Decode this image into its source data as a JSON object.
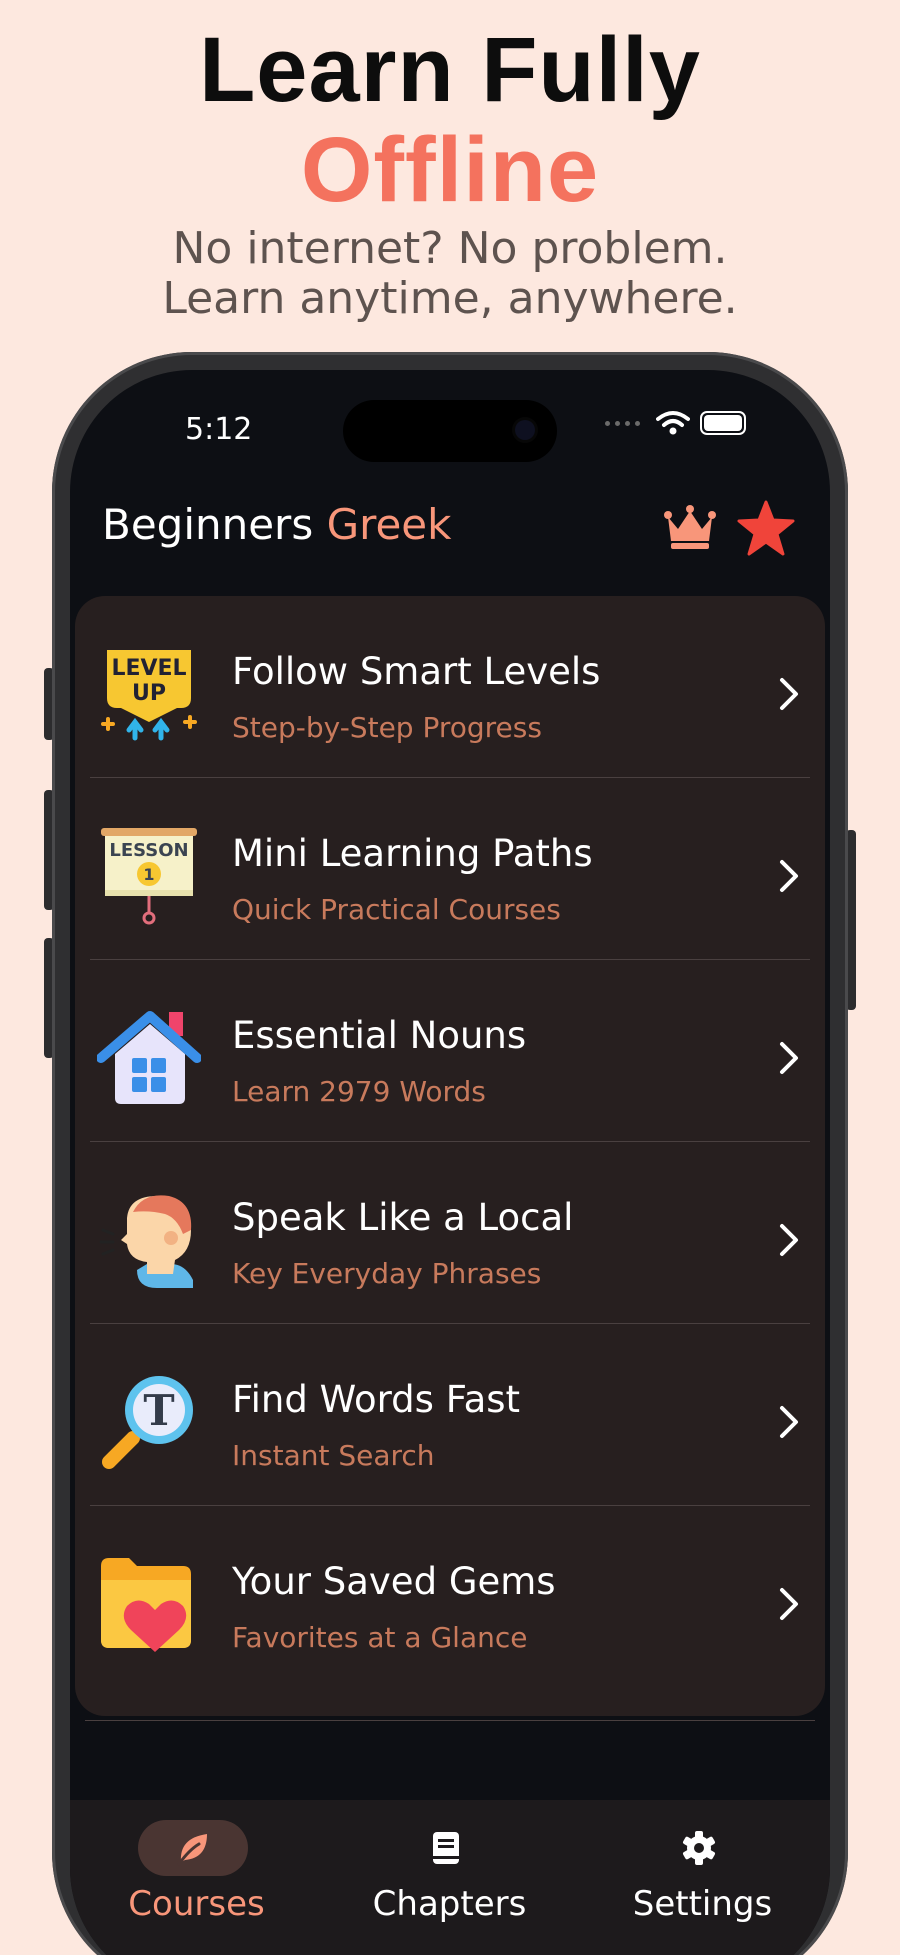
{
  "promo": {
    "title_line1": "Learn Fully",
    "title_line2": "Offline",
    "subtitle_line1": "No internet? No problem.",
    "subtitle_line2": "Learn anytime, anywhere."
  },
  "status_bar": {
    "time": "5:12"
  },
  "header": {
    "title_prefix": "Beginners",
    "title_accent": "Greek",
    "icons": [
      "crown-icon",
      "star-icon"
    ]
  },
  "menu": [
    {
      "title": "Follow Smart Levels",
      "subtitle": "Step-by-Step Progress",
      "icon": "level-up-icon",
      "icon_text_1": "LEVEL",
      "icon_text_2": "UP"
    },
    {
      "title": "Mini Learning Paths",
      "subtitle": "Quick Practical Courses",
      "icon": "lesson-board-icon",
      "icon_text_1": "LESSON",
      "icon_text_2": "1"
    },
    {
      "title": "Essential Nouns",
      "subtitle": "Learn 2979 Words",
      "icon": "house-icon"
    },
    {
      "title": "Speak Like a Local",
      "subtitle": "Key Everyday Phrases",
      "icon": "speaking-person-icon"
    },
    {
      "title": "Find Words Fast",
      "subtitle": "Instant Search",
      "icon": "magnifier-text-icon",
      "icon_text_1": "T"
    },
    {
      "title": "Your Saved Gems",
      "subtitle": "Favorites at a Glance",
      "icon": "heart-folder-icon"
    }
  ],
  "tabs": [
    {
      "label": "Courses",
      "icon": "leaf-icon",
      "active": true
    },
    {
      "label": "Chapters",
      "icon": "book-icon",
      "active": false
    },
    {
      "label": "Settings",
      "icon": "gear-icon",
      "active": false
    }
  ],
  "colors": {
    "background": "#fde8df",
    "accent": "#f8967a",
    "promo_accent": "#f4725e",
    "card": "#271f1f",
    "subtitle": "#c87a5c",
    "screen": "#0d0f14",
    "star": "#f0443a"
  }
}
